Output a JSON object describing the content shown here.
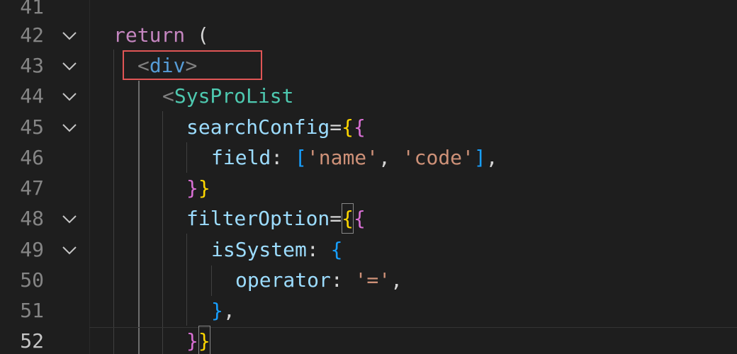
{
  "lines": [
    {
      "num": "41"
    },
    {
      "num": "42",
      "t1": "return",
      "t2": " ("
    },
    {
      "num": "43",
      "t1": "<",
      "t2": "div",
      "t3": ">"
    },
    {
      "num": "44",
      "t1": "<",
      "t2": "SysProList"
    },
    {
      "num": "45",
      "t1": "searchConfig",
      "t2": "=",
      "t3": "{",
      "t4": "{"
    },
    {
      "num": "46",
      "t1": "field",
      "t2": ": ",
      "t3": "[",
      "t4": "'name'",
      "t5": ", ",
      "t6": "'code'",
      "t7": "]",
      "t8": ","
    },
    {
      "num": "47",
      "t1": "}",
      "t2": "}"
    },
    {
      "num": "48",
      "t1": "filterOption",
      "t2": "=",
      "t3": "{",
      "t4": "{"
    },
    {
      "num": "49",
      "t1": "isSystem",
      "t2": ": ",
      "t3": "{"
    },
    {
      "num": "50",
      "t1": "operator",
      "t2": ": ",
      "t3": "'='",
      "t4": ","
    },
    {
      "num": "51",
      "t1": "}",
      "t2": ","
    },
    {
      "num": "52",
      "t1": "}",
      "t2": "}"
    }
  ],
  "icons": {
    "fold": "chevron-down-icon"
  },
  "colors": {
    "background": "#1e1e1e",
    "keyword": "#c586c0",
    "tag": "#569cd6",
    "component": "#4ec9b0",
    "attribute": "#9cdcfe",
    "string": "#ce9178",
    "bracket_gold": "#ffd700",
    "bracket_violet": "#da70d6",
    "bracket_blue": "#179fff",
    "highlight_box": "#e05555"
  }
}
